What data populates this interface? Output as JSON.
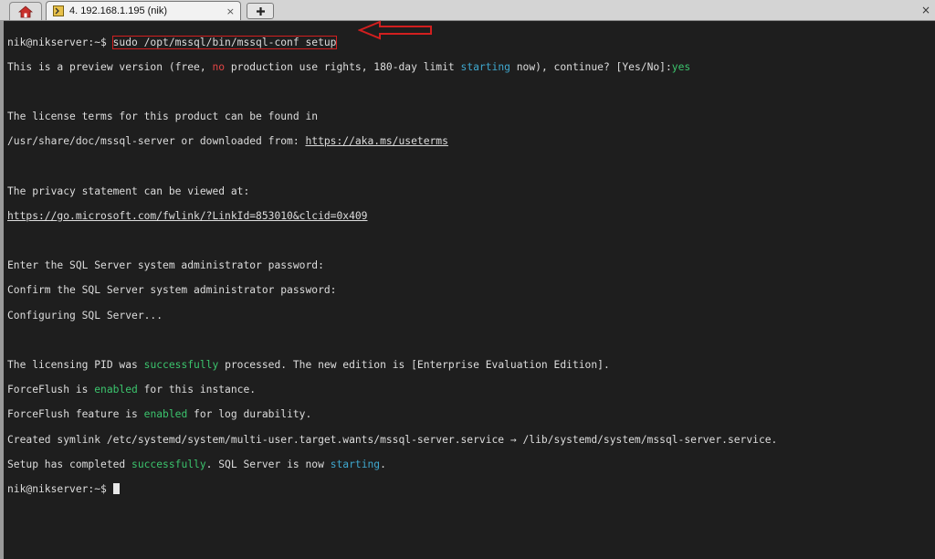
{
  "tab_bar": {
    "home_icon": "home-icon",
    "session_tab": {
      "icon": "terminal-icon",
      "label": "4. 192.168.1.195 (nik)",
      "close": "×"
    },
    "new_tab_icon": "plus-icon",
    "window_close": "×"
  },
  "terminal": {
    "prompt": "nik@nikserver:~$ ",
    "command": "sudo /opt/mssql/bin/mssql-conf setup",
    "preview": {
      "p1": "This is a preview version (free, ",
      "no": "no",
      "p2": " production use rights, 180-day limit ",
      "starting": "starting",
      "p3": " now), continue? [Yes/No]:",
      "answer": "yes"
    },
    "license_line1": "The license terms for this product can be found in",
    "license_line2_text": "/usr/share/doc/mssql-server or downloaded from: ",
    "license_link": "https://aka.ms/useterms",
    "privacy_line": "The privacy statement can be viewed at:",
    "privacy_link": "https://go.microsoft.com/fwlink/?LinkId=853010&clcid=0x409",
    "enter_password": "Enter the SQL Server system administrator password:",
    "confirm_password": "Confirm the SQL Server system administrator password:",
    "configuring": "Configuring SQL Server...",
    "pid": {
      "p1": "The licensing PID was ",
      "successfully": "successfully",
      "p2": " processed. The new edition is [Enterprise Evaluation Edition]."
    },
    "forceflush1": {
      "p1": "ForceFlush is ",
      "enabled": "enabled",
      "p2": " for this instance."
    },
    "forceflush2": {
      "p1": "ForceFlush feature is ",
      "enabled": "enabled",
      "p2": " for log durability."
    },
    "symlink": "Created symlink /etc/systemd/system/multi-user.target.wants/mssql-server.service → /lib/systemd/system/mssql-server.service.",
    "setup_done": {
      "p1": "Setup has completed ",
      "successfully": "successfully",
      "p2": ". SQL Server is now ",
      "starting": "starting",
      "p3": "."
    },
    "final_prompt": "nik@nikserver:~$ "
  },
  "annotation": {
    "arrow_icon": "left-arrow-icon",
    "color": "#d21f1f"
  }
}
